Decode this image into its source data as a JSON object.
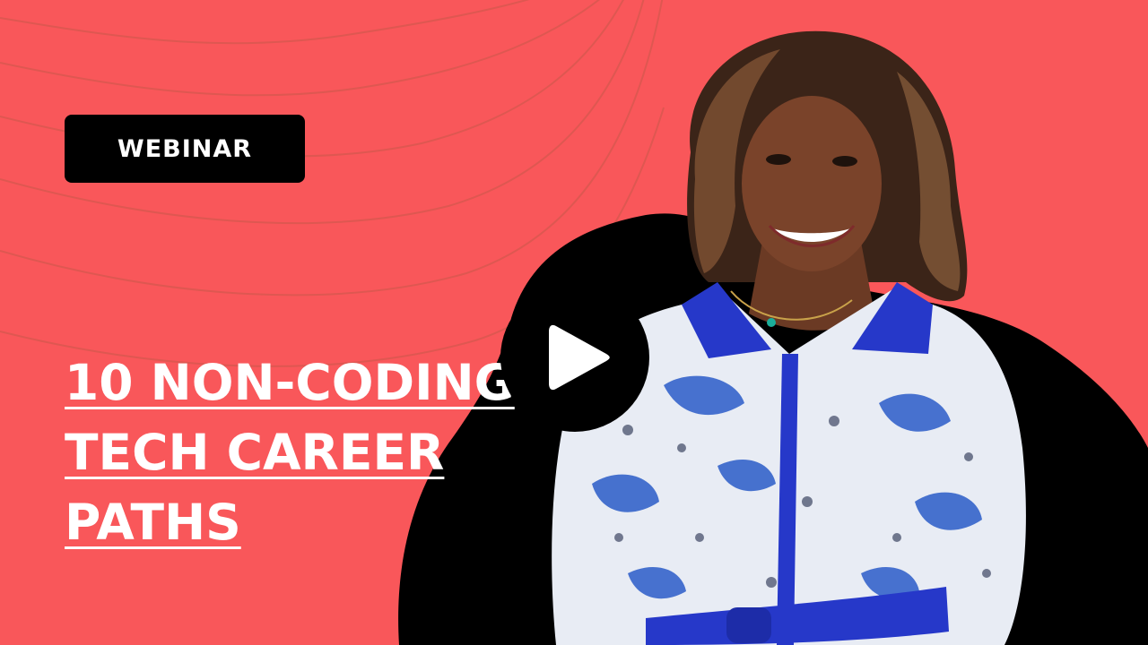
{
  "badge": {
    "label": "WEBINAR"
  },
  "headline": {
    "lines": [
      "10 NON-CODING",
      "TECH CAREER",
      "PATHS"
    ]
  },
  "video": {
    "play_icon": "play-icon"
  },
  "colors": {
    "background": "#F9575A",
    "blob": "#000000",
    "badge_bg": "#000000",
    "text": "#FFFFFF",
    "accent_blue": "#2638C9"
  }
}
